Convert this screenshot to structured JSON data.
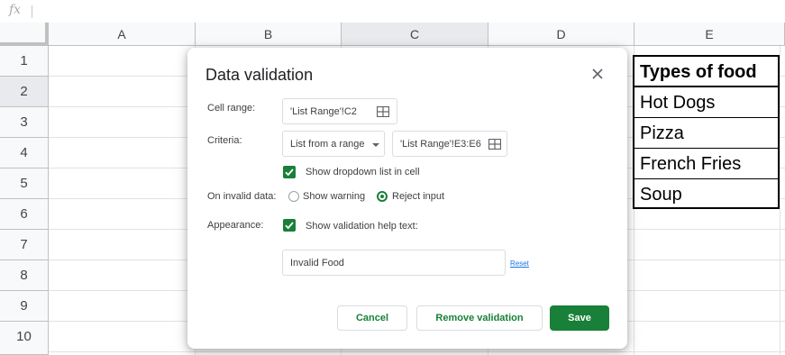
{
  "formula_bar": {
    "fx_label": "fx"
  },
  "columns": [
    "A",
    "B",
    "C",
    "D",
    "E"
  ],
  "rows": [
    "1",
    "2",
    "3",
    "4",
    "5",
    "6",
    "7",
    "8",
    "9",
    "10"
  ],
  "food_table": {
    "header": "Types of food",
    "items": [
      "Hot Dogs",
      "Pizza",
      "French Fries",
      "Soup"
    ]
  },
  "dialog": {
    "title": "Data validation",
    "close_icon": "close-icon",
    "cell_range_label": "Cell range:",
    "cell_range_value": "'List Range'!C2",
    "criteria_label": "Criteria:",
    "criteria_type": "List from a range",
    "criteria_range": "'List Range'!E3:E6",
    "show_dropdown_label": "Show dropdown list in cell",
    "show_dropdown_checked": true,
    "on_invalid_label": "On invalid data:",
    "show_warning_label": "Show warning",
    "reject_input_label": "Reject input",
    "on_invalid_selected": "reject_input",
    "appearance_label": "Appearance:",
    "show_help_label": "Show validation help text:",
    "show_help_checked": true,
    "help_text_value": "Invalid Food",
    "reset_label": "Reset",
    "cancel_label": "Cancel",
    "remove_label": "Remove validation",
    "save_label": "Save"
  },
  "colors": {
    "accent_green": "#188038",
    "link_blue": "#1a73e8"
  }
}
